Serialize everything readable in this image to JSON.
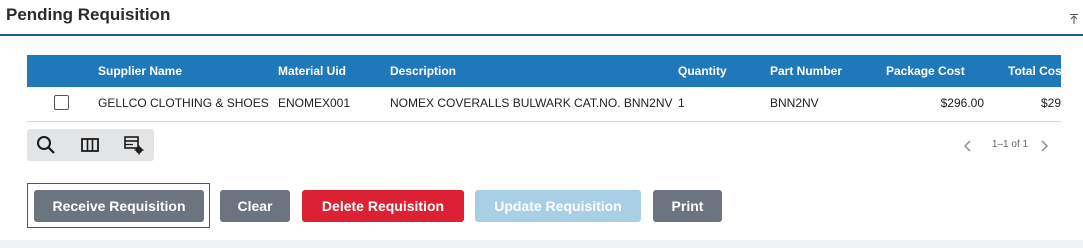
{
  "panel": {
    "title": "Pending Requisition",
    "collapse_icon": "collapse-up-icon"
  },
  "grid": {
    "columns": {
      "supplier_name": "Supplier Name",
      "material_uid": "Material Uid",
      "description": "Description",
      "quantity": "Quantity",
      "part_number": "Part Number",
      "package_cost": "Package Cost",
      "total_cost": "Total Cos"
    },
    "rows": [
      {
        "checked": false,
        "supplier_name": "GELLCO CLOTHING & SHOES",
        "material_uid": "ENOMEX001",
        "description": "NOMEX COVERALLS BULWARK CAT.NO. BNN2NV",
        "quantity": "1",
        "part_number": "BNN2NV",
        "package_cost": "$296.00",
        "total_cost": "$29"
      }
    ]
  },
  "toolbar": {
    "icons": [
      "search-icon",
      "columns-icon",
      "grid-settings-icon"
    ]
  },
  "pager": {
    "info": "1–1 of 1",
    "prev_icon": "chevron-left-icon",
    "next_icon": "chevron-right-icon"
  },
  "actions": {
    "receive_label": "Receive Requisition",
    "clear_label": "Clear",
    "delete_label": "Delete Requisition",
    "update_label": "Update Requisition",
    "print_label": "Print"
  },
  "colors": {
    "header_blue": "#1f78b9",
    "title_underline": "#1f5f86",
    "button_gray": "#6c7480",
    "button_red": "#dc2232",
    "button_disabled": "#a9cfe6",
    "focus_outline": "#b92a2a"
  }
}
